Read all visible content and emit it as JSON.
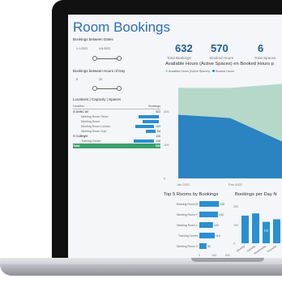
{
  "dashboard": {
    "title": "Room Bookings"
  },
  "filters": {
    "dates_label": "Bookings between Dates",
    "date_start": "1-1-2022",
    "date_end": "4-5-2022",
    "hours_label": "Bookings between Hours of Day",
    "hour_start": "8",
    "hour_end": "16"
  },
  "table": {
    "title": "Locations | Capacity | Spaces",
    "col_location": "Location",
    "col_bookings": "Bookings",
    "rows": [
      {
        "label": "ANNC AV",
        "value": "522",
        "bar": 0,
        "group": true
      },
      {
        "label": "Meeting Room Sever",
        "value": "",
        "bar": 0.62,
        "group": false
      },
      {
        "label": "Meeting Room",
        "value": "",
        "bar": 0.5,
        "group": false
      },
      {
        "label": "Meeting Room London",
        "value": "103",
        "bar": 0.58,
        "group": false
      },
      {
        "label": "Meeting Room Zuid",
        "value": "54",
        "bar": 0.3,
        "group": false
      },
      {
        "label": "GoBright",
        "value": "116",
        "bar": 0,
        "group": true
      },
      {
        "label": "Training Center",
        "value": "116",
        "bar": 0.62,
        "group": false
      }
    ],
    "total_label": "Total",
    "total_value": "632"
  },
  "kpis": [
    {
      "value": "632",
      "label": "Total Bookings"
    },
    {
      "value": "570",
      "label": "Booked Hours"
    },
    {
      "value": "6",
      "label": "Total Spaces"
    }
  ],
  "area_chart": {
    "title": "Available Hours (Active Spaces) en Booked Hours p",
    "legend_available": "Available Hours (Active Spaces)",
    "legend_booked": "Booked Hours",
    "color_available": "#b5d8c9",
    "color_booked": "#2b83c2"
  },
  "top_rooms": {
    "title": "Top 5 Rooms by Bookings",
    "color": "#2a8fd2"
  },
  "per_day": {
    "title": "Bookings per Day N",
    "color": "#2a8fd2"
  },
  "chart_data": [
    {
      "type": "area",
      "title": "Available Hours (Active Spaces) en Booked Hours p",
      "x": [
        "Jan 2022",
        "Feb 2022",
        "Mar 2022"
      ],
      "ylim": [
        0,
        300
      ],
      "yticks": [
        0,
        100,
        200
      ],
      "series": [
        {
          "name": "Available Hours (Active Spaces)",
          "values": [
            270,
            270,
            282
          ]
        },
        {
          "name": "Booked Hours",
          "values": [
            190,
            180,
            110
          ]
        }
      ]
    },
    {
      "type": "bar",
      "title": "Top 5 Rooms by Bookings",
      "categories": [
        "Meeting Room B",
        "Meeting Room F",
        "Meeting Room L",
        "Training Center",
        "Meeting Room Z"
      ],
      "values": [
        148,
        140,
        103,
        116,
        54
      ],
      "labels": [
        "148",
        "140",
        "103",
        "116",
        "54"
      ],
      "xticks": [
        "0",
        "100",
        "200"
      ],
      "xlim": [
        0,
        220
      ]
    },
    {
      "type": "bar",
      "title": "Bookings per Day N",
      "categories": [
        "Monday",
        "Tuesday",
        "Wednesday",
        "Thursday"
      ],
      "values": [
        150,
        162,
        116,
        130
      ],
      "labels": [
        "",
        "",
        "116",
        ""
      ],
      "yticks": [
        "0",
        "100",
        "200"
      ],
      "ylim": [
        0,
        220
      ]
    }
  ]
}
